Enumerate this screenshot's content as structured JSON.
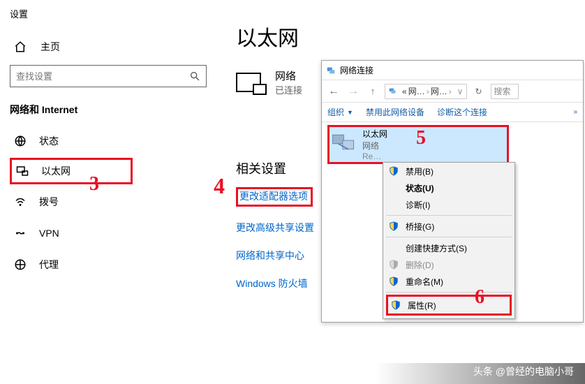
{
  "settings": {
    "appTitle": "设置",
    "homeLabel": "主页",
    "searchPlaceholder": "查找设置",
    "groupTitle": "网络和 Internet",
    "nav": [
      {
        "label": "状态"
      },
      {
        "label": "以太网"
      },
      {
        "label": "拨号"
      },
      {
        "label": "VPN"
      },
      {
        "label": "代理"
      }
    ]
  },
  "page": {
    "title": "以太网",
    "networkName": "网络",
    "networkStatus": "已连接",
    "relatedTitle": "相关设置",
    "links": [
      "更改适配器选项",
      "更改高级共享设置",
      "网络和共享中心",
      "Windows 防火墙"
    ]
  },
  "win": {
    "title": "网络连接",
    "breadcrumb": {
      "seg1": "网…",
      "seg2": "网…"
    },
    "searchHint": "搜索",
    "toolbar": {
      "org": "组织",
      "disable": "禁用此网络设备",
      "diag": "诊断这个连接"
    },
    "adapter": {
      "name": "以太网",
      "net": "网络",
      "driver": "Re…"
    }
  },
  "ctx": {
    "items": [
      {
        "label": "禁用(B)",
        "shield": true
      },
      {
        "label": "状态(U)",
        "bold": true
      },
      {
        "label": "诊断(I)"
      },
      {
        "label": "桥接(G)",
        "shield": true
      },
      {
        "label": "创建快捷方式(S)"
      },
      {
        "label": "删除(D)",
        "shield": true,
        "disabled": true
      },
      {
        "label": "重命名(M)",
        "shield": true
      },
      {
        "label": "属性(R)",
        "shield": true
      }
    ]
  },
  "anno": {
    "a3": "3",
    "a4": "4",
    "a5": "5",
    "a6": "6"
  },
  "watermark": "头条 @曾经的电脑小哥"
}
